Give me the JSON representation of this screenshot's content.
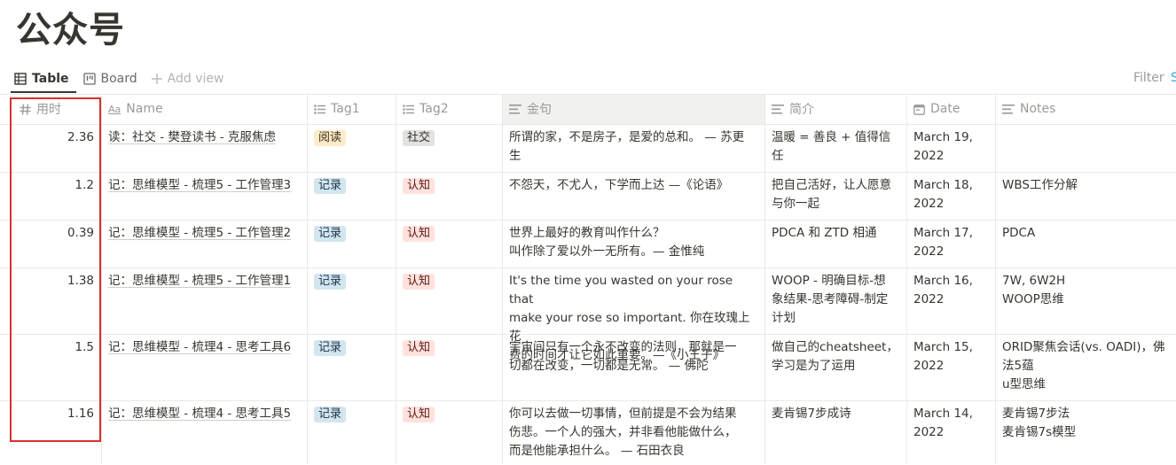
{
  "page": {
    "title": "公众号"
  },
  "views": {
    "table_label": "Table",
    "board_label": "Board",
    "add_view_label": "Add view",
    "filter_label": "Filter",
    "filter_cut": "S"
  },
  "columns": [
    "用时",
    "Name",
    "Tag1",
    "Tag2",
    "金句",
    "简介",
    "Date",
    "Notes"
  ],
  "rows": [
    {
      "time": "2.36",
      "name": "读：社交 - 樊登读书 - 克服焦虑",
      "tag1": "阅读",
      "tag2": "社交",
      "quote": [
        "所谓的家，不是房子，是爱的总和。 — 苏更",
        "生"
      ],
      "intro": [
        "温暖 = 善良 + 值得信",
        "任"
      ],
      "date": [
        "March 19,",
        "2022"
      ],
      "notes": []
    },
    {
      "time": "1.2",
      "name": "记：思维模型 - 梳理5 - 工作管理3",
      "tag1": "记录",
      "tag2": "认知",
      "quote": [
        "不怨天，不尤人，下学而上达 —《论语》"
      ],
      "intro": [
        "把自己活好，让人愿意",
        "与你一起"
      ],
      "date": [
        "March 18,",
        "2022"
      ],
      "notes": [
        "WBS工作分解"
      ]
    },
    {
      "time": "0.39",
      "name": "记：思维模型 - 梳理5 - 工作管理2",
      "tag1": "记录",
      "tag2": "认知",
      "quote": [
        "世界上最好的教育叫作什么？",
        "叫作除了爱以外一无所有。— 金惟纯"
      ],
      "intro": [
        "PDCA 和 ZTD 相通"
      ],
      "date": [
        "March 17,",
        "2022"
      ],
      "notes": [
        "PDCA"
      ]
    },
    {
      "time": "1.38",
      "name": "记：思维模型 - 梳理5 - 工作管理1",
      "tag1": "记录",
      "tag2": "认知",
      "quote": [
        "It's the time you wasted on your rose that",
        "make your rose so important. 你在玫瑰上花",
        "费的时间才让它如此重要。—《小王子》"
      ],
      "intro": [
        "WOOP - 明确目标-想",
        "象结果-思考障碍-制定",
        "计划"
      ],
      "date": [
        "March 16,",
        "2022"
      ],
      "notes": [
        "7W, 6W2H",
        "WOOP思维"
      ]
    },
    {
      "time": "1.5",
      "name": "记：思维模型 - 梳理4 - 思考工具6",
      "tag1": "记录",
      "tag2": "认知",
      "quote": [
        "宇宙间只有一个永不改变的法则，那就是一",
        "切都在改变，一切都是无常。 — 佛陀"
      ],
      "intro": [
        "做自己的cheatsheet，",
        "学习是为了运用"
      ],
      "date": [
        "March 15,",
        "2022"
      ],
      "notes": [
        "ORID聚焦会话(vs. OADI)，佛",
        "法5蕴",
        "u型思维"
      ]
    },
    {
      "time": "1.16",
      "name": "记：思维模型 - 梳理4 - 思考工具5",
      "tag1": "记录",
      "tag2": "认知",
      "quote": [
        "你可以去做一切事情，但前提是不会为结果",
        "伤悲。一个人的强大，并非看他能做什么，",
        "而是他能承担什么。 — 石田衣良"
      ],
      "intro": [
        "麦肯锡7步成诗"
      ],
      "date": [
        "March 14,",
        "2022"
      ],
      "notes": [
        "麦肯锡7步法",
        "麦肯锡7s模型"
      ]
    }
  ],
  "colors": {
    "tag_read_bg": "#fdecc8",
    "tag_read_fg": "#402c1b",
    "tag_social_bg": "#e3e2e0",
    "tag_social_fg": "#32302c",
    "tag_record_bg": "#d3e5ef",
    "tag_record_fg": "#183347",
    "tag_cognition_bg": "#ffe2dd",
    "tag_cognition_fg": "#5d1715",
    "highlight_border": "#d9302e"
  }
}
